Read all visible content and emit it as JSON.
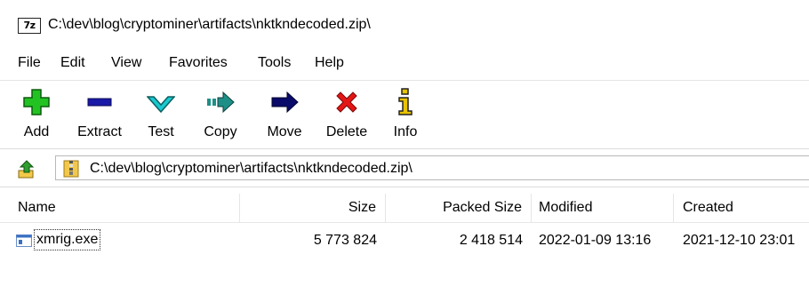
{
  "window": {
    "app_logo": "7z",
    "title": "C:\\dev\\blog\\cryptominer\\artifacts\\nktkndecoded.zip\\"
  },
  "menu": [
    "File",
    "Edit",
    "View",
    "Favorites",
    "Tools",
    "Help"
  ],
  "toolbar": [
    {
      "label": "Add",
      "icon": "plus-icon",
      "color": "#22c222"
    },
    {
      "label": "Extract",
      "icon": "minus-icon",
      "color": "#1a1aa8"
    },
    {
      "label": "Test",
      "icon": "check-chevron-icon",
      "color": "#19c9cf"
    },
    {
      "label": "Copy",
      "icon": "copy-arrow-icon",
      "color": "#1e8f87"
    },
    {
      "label": "Move",
      "icon": "move-arrow-icon",
      "color": "#0a0a6a"
    },
    {
      "label": "Delete",
      "icon": "x-icon",
      "color": "#e51616"
    },
    {
      "label": "Info",
      "icon": "info-icon",
      "color": "#e8c400"
    }
  ],
  "address": {
    "path": "C:\\dev\\blog\\cryptominer\\artifacts\\nktkndecoded.zip\\"
  },
  "columns": {
    "name": "Name",
    "size": "Size",
    "packed_size": "Packed Size",
    "modified": "Modified",
    "created": "Created"
  },
  "files": [
    {
      "name": "xmrig.exe",
      "size": "5 773 824",
      "packed_size": "2 418 514",
      "modified": "2022-01-09 13:16",
      "created": "2021-12-10 23:01"
    }
  ]
}
